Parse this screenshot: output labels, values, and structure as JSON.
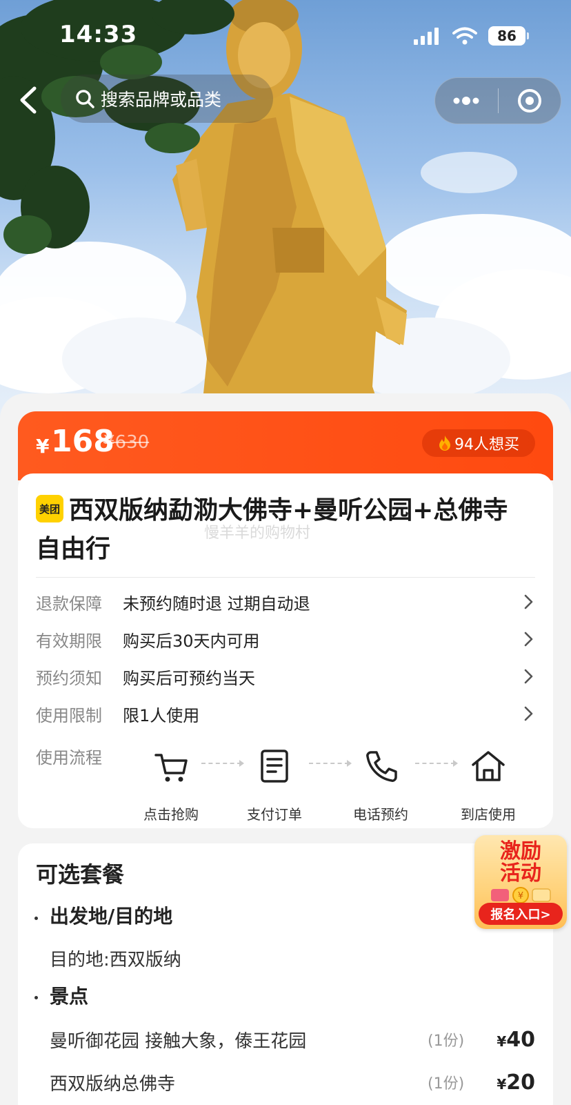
{
  "status_bar": {
    "time": "14:33",
    "battery": "86"
  },
  "nav": {
    "search_placeholder": "搜索品牌或品类"
  },
  "price": {
    "currency": "¥",
    "value": "168",
    "original": "¥630",
    "want_count": "94人想买"
  },
  "product": {
    "brand_badge": "美团",
    "title": "西双版纳勐泐大佛寺+曼听公园+总佛寺自由行",
    "watermark": "慢羊羊的购物村"
  },
  "details": [
    {
      "label": "退款保障",
      "value": "未预约随时退 过期自动退"
    },
    {
      "label": "有效期限",
      "value": "购买后30天内可用"
    },
    {
      "label": "预约须知",
      "value": "购买后可预约当天"
    },
    {
      "label": "使用限制",
      "value": "限1人使用"
    }
  ],
  "flow": {
    "label": "使用流程",
    "steps": [
      {
        "icon": "cart-icon",
        "text": "点击抢购"
      },
      {
        "icon": "order-icon",
        "text": "支付订单"
      },
      {
        "icon": "phone-icon",
        "text": "电话预约"
      },
      {
        "icon": "home-icon",
        "text": "到店使用"
      }
    ]
  },
  "packages": {
    "title": "可选套餐",
    "origin_section": "出发地/目的地",
    "destination": "目的地:西双版纳",
    "spots_section": "景点",
    "items": [
      {
        "name": "曼听御花园 接触大象，傣王花园",
        "qty": "(1份)",
        "currency": "¥",
        "price": "40"
      },
      {
        "name": "西双版纳总佛寺",
        "qty": "(1份)",
        "currency": "¥",
        "price": "20"
      }
    ]
  },
  "promo": {
    "line1": "激励",
    "line2": "活动",
    "button": "报名入口>"
  },
  "colors": {
    "accent": "#ff4a10",
    "brand_yellow": "#ffd100",
    "promo_red": "#e8241c"
  }
}
